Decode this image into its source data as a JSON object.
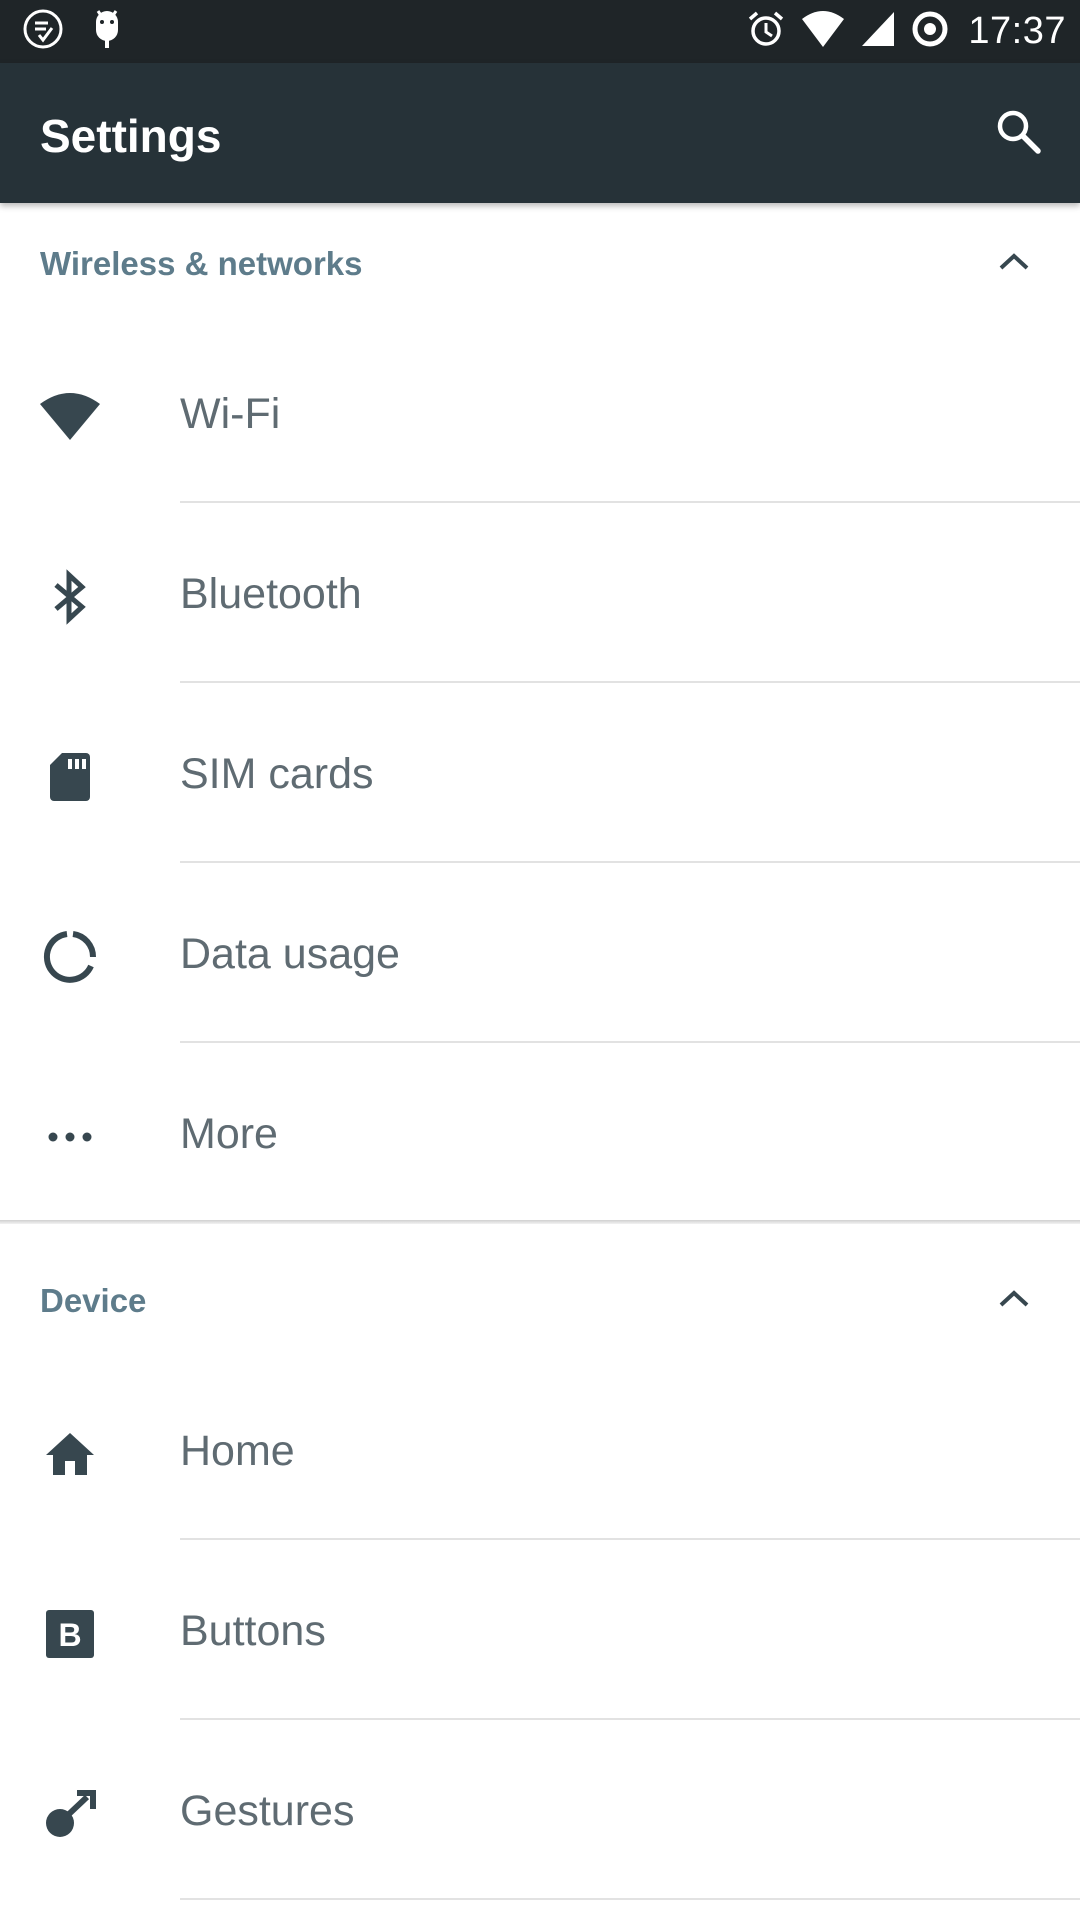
{
  "status_bar": {
    "time": "17:37",
    "left_icons": [
      "browser-badge-icon",
      "android-notification-icon"
    ],
    "right_icons": [
      "alarm-icon",
      "wifi-signal-icon",
      "cell-signal-icon",
      "sync-ring-icon"
    ]
  },
  "app_bar": {
    "title": "Settings",
    "search_icon": "search-icon"
  },
  "sections": [
    {
      "title": "Wireless & networks",
      "items": [
        {
          "label": "Wi-Fi",
          "icon": "wifi-icon"
        },
        {
          "label": "Bluetooth",
          "icon": "bluetooth-icon"
        },
        {
          "label": "SIM cards",
          "icon": "sim-card-icon"
        },
        {
          "label": "Data usage",
          "icon": "data-usage-icon"
        },
        {
          "label": "More",
          "icon": "more-horiz-icon"
        }
      ]
    },
    {
      "title": "Device",
      "items": [
        {
          "label": "Home",
          "icon": "home-icon"
        },
        {
          "label": "Buttons",
          "icon": "buttons-icon"
        },
        {
          "label": "Gestures",
          "icon": "gestures-icon"
        }
      ]
    }
  ],
  "colors": {
    "status_bar": "#1f2528",
    "app_bar": "#263238",
    "section_title": "#5e7c8b",
    "item_icon": "#37474f",
    "item_label": "#5f6b72"
  }
}
